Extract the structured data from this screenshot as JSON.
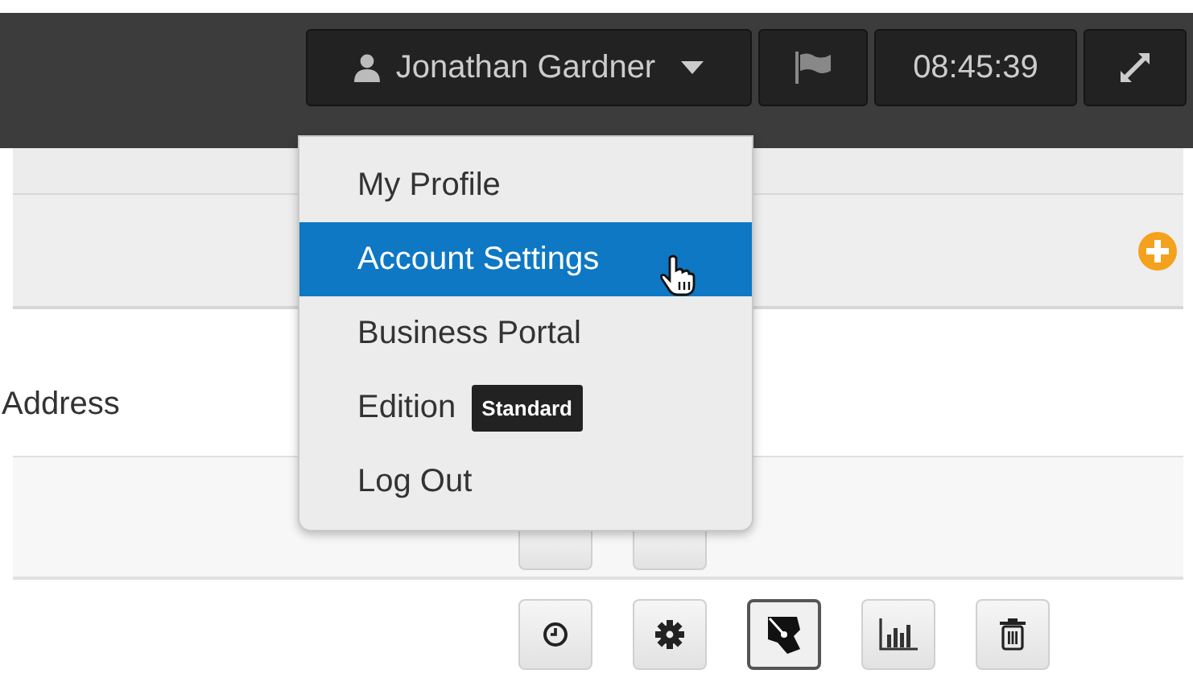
{
  "topbar": {
    "user_name": "Jonathan Gardner",
    "clock": "08:45:39"
  },
  "user_menu": {
    "items": [
      {
        "kind": "link",
        "label": "My Profile",
        "selected": false
      },
      {
        "kind": "link",
        "label": "Account Settings",
        "selected": true
      },
      {
        "kind": "link",
        "label": "Business Portal",
        "selected": false
      },
      {
        "kind": "edition",
        "label": "Edition",
        "badge": "Standard",
        "selected": false
      },
      {
        "kind": "link",
        "label": "Log Out",
        "selected": false
      }
    ]
  },
  "table": {
    "rows": [
      {
        "label": "Address"
      }
    ]
  },
  "row_actions": [
    {
      "kind": "history",
      "selected": false
    },
    {
      "kind": "settings",
      "selected": false
    },
    {
      "kind": "map",
      "selected": true
    },
    {
      "kind": "chart",
      "selected": false
    },
    {
      "kind": "delete",
      "selected": false
    }
  ]
}
